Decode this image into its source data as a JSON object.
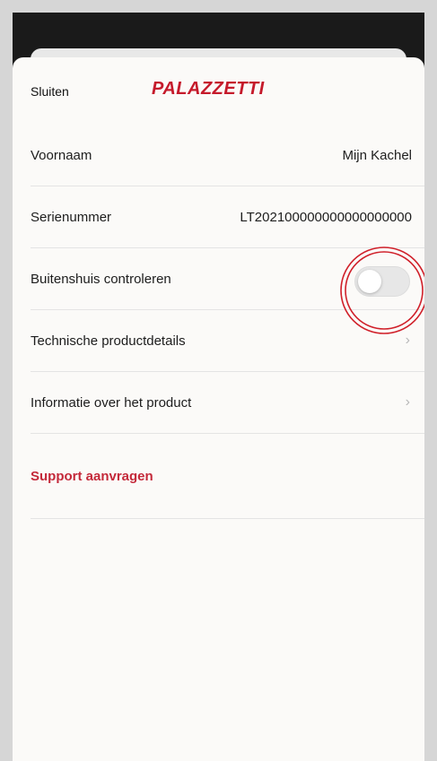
{
  "header": {
    "close_label": "Sluiten",
    "logo_text": "PALAZZETTI"
  },
  "rows": [
    {
      "label": "Voornaam",
      "value": "Mijn Kachel"
    },
    {
      "label": "Serienummer",
      "value": "LT202100000000000000000"
    },
    {
      "label": "Buitenshuis controleren",
      "toggle_on": false
    },
    {
      "label": "Technische productdetails"
    },
    {
      "label": "Informatie over het product"
    }
  ],
  "support": {
    "label": "Support aanvragen"
  },
  "colors": {
    "brand": "#c51a2b",
    "annotation": "#d0202a"
  },
  "icons": {
    "chevron": "chevron-right-icon"
  }
}
